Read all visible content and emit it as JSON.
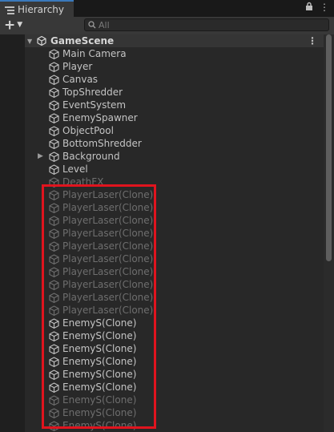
{
  "window": {
    "tab_title": "Hierarchy"
  },
  "toolbar": {
    "search_placeholder": "All",
    "add_symbol": "+",
    "add_caret": "▼",
    "menu_symbol": "⋮",
    "lock_symbol": "🔒"
  },
  "scene": {
    "name": "GameScene"
  },
  "rows": [
    {
      "label": "Main Camera",
      "active": true,
      "expandable": false
    },
    {
      "label": "Player",
      "active": true,
      "expandable": false
    },
    {
      "label": "Canvas",
      "active": true,
      "expandable": false
    },
    {
      "label": "TopShredder",
      "active": true,
      "expandable": false
    },
    {
      "label": "EventSystem",
      "active": true,
      "expandable": false
    },
    {
      "label": "EnemySpawner",
      "active": true,
      "expandable": false
    },
    {
      "label": "ObjectPool",
      "active": true,
      "expandable": false
    },
    {
      "label": "BottomShredder",
      "active": true,
      "expandable": false
    },
    {
      "label": "Background",
      "active": true,
      "expandable": true
    },
    {
      "label": "Level",
      "active": true,
      "expandable": false
    },
    {
      "label": "DeathFX",
      "active": false,
      "expandable": false
    },
    {
      "label": "PlayerLaser(Clone)",
      "active": false,
      "expandable": false
    },
    {
      "label": "PlayerLaser(Clone)",
      "active": false,
      "expandable": false
    },
    {
      "label": "PlayerLaser(Clone)",
      "active": false,
      "expandable": false
    },
    {
      "label": "PlayerLaser(Clone)",
      "active": false,
      "expandable": false
    },
    {
      "label": "PlayerLaser(Clone)",
      "active": false,
      "expandable": false
    },
    {
      "label": "PlayerLaser(Clone)",
      "active": false,
      "expandable": false
    },
    {
      "label": "PlayerLaser(Clone)",
      "active": false,
      "expandable": false
    },
    {
      "label": "PlayerLaser(Clone)",
      "active": false,
      "expandable": false
    },
    {
      "label": "PlayerLaser(Clone)",
      "active": false,
      "expandable": false
    },
    {
      "label": "PlayerLaser(Clone)",
      "active": false,
      "expandable": false
    },
    {
      "label": "EnemyS(Clone)",
      "active": true,
      "expandable": false
    },
    {
      "label": "EnemyS(Clone)",
      "active": true,
      "expandable": false
    },
    {
      "label": "EnemyS(Clone)",
      "active": true,
      "expandable": false
    },
    {
      "label": "EnemyS(Clone)",
      "active": true,
      "expandable": false
    },
    {
      "label": "EnemyS(Clone)",
      "active": true,
      "expandable": false
    },
    {
      "label": "EnemyS(Clone)",
      "active": true,
      "expandable": false
    },
    {
      "label": "EnemyS(Clone)",
      "active": false,
      "expandable": false
    },
    {
      "label": "EnemyS(Clone)",
      "active": false,
      "expandable": false
    },
    {
      "label": "EnemyS(Clone)",
      "active": false,
      "expandable": false
    }
  ],
  "colors": {
    "accent_tab": "#3a79bb",
    "highlight_box": "#e0141e",
    "active_text": "#c4c4c4",
    "inactive_text": "#6e6e6e"
  }
}
